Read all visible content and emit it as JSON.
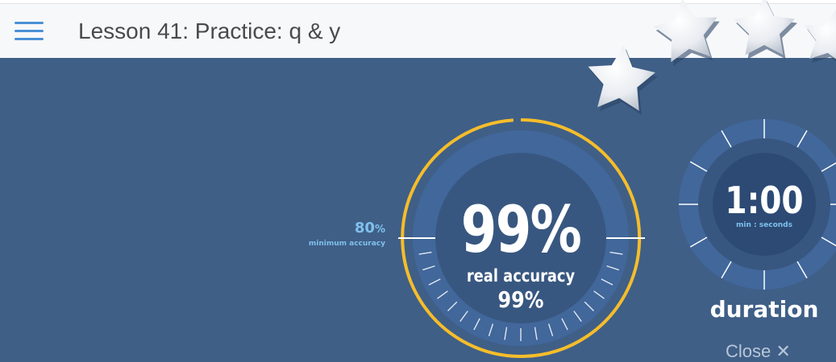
{
  "header": {
    "title": "Lesson 41: Practice: q & y",
    "menu_icon": "hamburger-menu-icon"
  },
  "accuracy": {
    "minimum_value": "80",
    "minimum_unit": "%",
    "minimum_label": "minimum accuracy",
    "main_value": "99%",
    "real_label": "real accuracy",
    "real_value": "99%",
    "progress_fraction": 0.99
  },
  "timer": {
    "value": "1:00",
    "unit_label": "min : seconds",
    "label": "duration"
  },
  "footer": {
    "close_label": "Close ✕"
  },
  "decor": {
    "star_icon": "star-icon",
    "accent_color": "#f6bd2a",
    "background_color": "#3f5f87"
  }
}
